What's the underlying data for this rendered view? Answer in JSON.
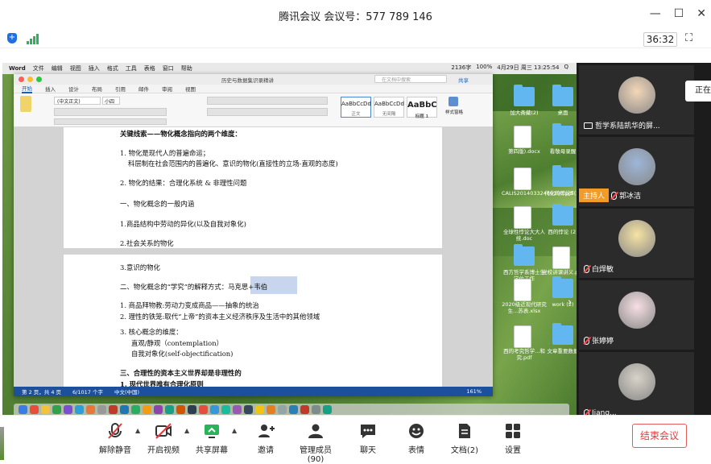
{
  "window": {
    "title": "腾讯会议 会议号：577 789 146"
  },
  "topbar": {
    "timer": "36:32"
  },
  "share": {
    "mac_menu": [
      "Word",
      "文件",
      "编辑",
      "视图",
      "插入",
      "格式",
      "工具",
      "表格",
      "窗口",
      "帮助"
    ],
    "mac_status": [
      "2136字",
      "100%",
      "4月29日 周三 13:25:54",
      "Q"
    ],
    "word": {
      "doc_title": "历史与数据集识录精讲",
      "search_placeholder": "在文档中搜索",
      "share_label": "共享",
      "tabs": [
        "开始",
        "插入",
        "设计",
        "布局",
        "引用",
        "邮件",
        "审阅",
        "视图"
      ],
      "font_name": "(中文正文)",
      "font_size": "小四",
      "styles": [
        {
          "preview": "AaBbCcDd",
          "name": "正文"
        },
        {
          "preview": "AaBbCcDd",
          "name": "无间隔"
        },
        {
          "preview": "AaBbC",
          "name": "标题 1"
        }
      ],
      "style_pane": "样式窗格",
      "status": [
        "第 2 页，共 4 页",
        "6/1017 个字",
        "中文(中国)",
        "161%"
      ],
      "lines": [
        {
          "t": "关键线索——物化概念指向的两个维度：",
          "b": true
        },
        {
          "t": "1. 物化是现代人的普遍命运；",
          "b": false
        },
        {
          "t": "科层制在社会范围内的普遍化、意识的物化(直接性的立场-直观的态度)",
          "b": false
        },
        {
          "t": "2. 物化的结果：合理化系统 & 非理性问题",
          "b": false
        },
        {
          "t": "一、物化概念的一般内涵",
          "b": false
        },
        {
          "t": "1.商品结构中劳动的异化(以及自我对象化)",
          "b": false
        },
        {
          "t": "2.社会关系的物化",
          "b": false
        },
        {
          "t": "3.意识的物化",
          "b": false
        },
        {
          "t": "二、物化概念的“学究”的解释方式：马克思+韦伯",
          "b": false
        },
        {
          "t": "1. 商品拜物教:劳动力变成商品——抽象的统治",
          "b": false
        },
        {
          "t": "2. 理性的铁笼:取代“上帝”的资本主义经济秩序及生活中的其他领域",
          "b": false
        },
        {
          "t": "3. 核心概念的维度：",
          "b": false
        },
        {
          "t": "直观/静观（contemplation）",
          "b": false
        },
        {
          "t": "自我对象化(self-objectification)",
          "b": false
        },
        {
          "t": "三、合理性的资本主义世界却是非理性的",
          "b": true
        },
        {
          "t": "1. 现代世界唯有合理化原则",
          "b": true
        },
        {
          "t": "2. 时间的空间化",
          "b": true
        }
      ]
    },
    "desktop": [
      {
        "label": "加大斋藏(2)"
      },
      {
        "label": "桌面"
      },
      {
        "label": "第四版).docx"
      },
      {
        "label": "看敬母录醒"
      },
      {
        "label": "CALIS20140332486100.pdf"
      },
      {
        "label": "代化的悖论5(2)"
      },
      {
        "label": "全球性悖论大大人统.doc"
      },
      {
        "label": "西的悖论 (2)"
      },
      {
        "label": "西方哲学系博士生学位工作"
      },
      {
        "label": "党校讲课讲义.pdf"
      },
      {
        "label": "2020级近现代研究生...苏表.xlsx"
      },
      {
        "label": "work (2)"
      },
      {
        "label": "西的考究哲学...和究.pdf"
      },
      {
        "label": "文章重要数据"
      }
    ]
  },
  "participants": [
    {
      "name": "哲学系陆凯华的屏...",
      "role": "",
      "muted": false,
      "sharing": true
    },
    {
      "name": "郭冰洁",
      "role": "主持人",
      "muted": true,
      "sharing": false
    },
    {
      "name": "白焊敏",
      "role": "",
      "muted": true,
      "sharing": false
    },
    {
      "name": "张婷婷",
      "role": "",
      "muted": true,
      "sharing": false
    },
    {
      "name": "Jiang...",
      "role": "",
      "muted": true,
      "sharing": false
    }
  ],
  "sidetab": {
    "label": "正在"
  },
  "toolbar": {
    "items": [
      {
        "label": "解除静音",
        "icon": "mic-muted-icon"
      },
      {
        "label": "开启视频",
        "icon": "camera-off-icon"
      },
      {
        "label": "共享屏幕",
        "icon": "share-screen-icon"
      },
      {
        "label": "邀请",
        "icon": "add-user-icon"
      },
      {
        "label": "管理成员(90)",
        "icon": "members-icon"
      },
      {
        "label": "聊天",
        "icon": "chat-icon"
      },
      {
        "label": "表情",
        "icon": "emoji-icon"
      },
      {
        "label": "文档(2)",
        "icon": "document-icon"
      },
      {
        "label": "设置",
        "icon": "settings-icon"
      }
    ],
    "end_label": "结束会议"
  },
  "colors": {
    "accent": "#1e6fe5",
    "end": "#e13c3c",
    "host": "#f29b26",
    "share_green": "#2bb35b"
  }
}
